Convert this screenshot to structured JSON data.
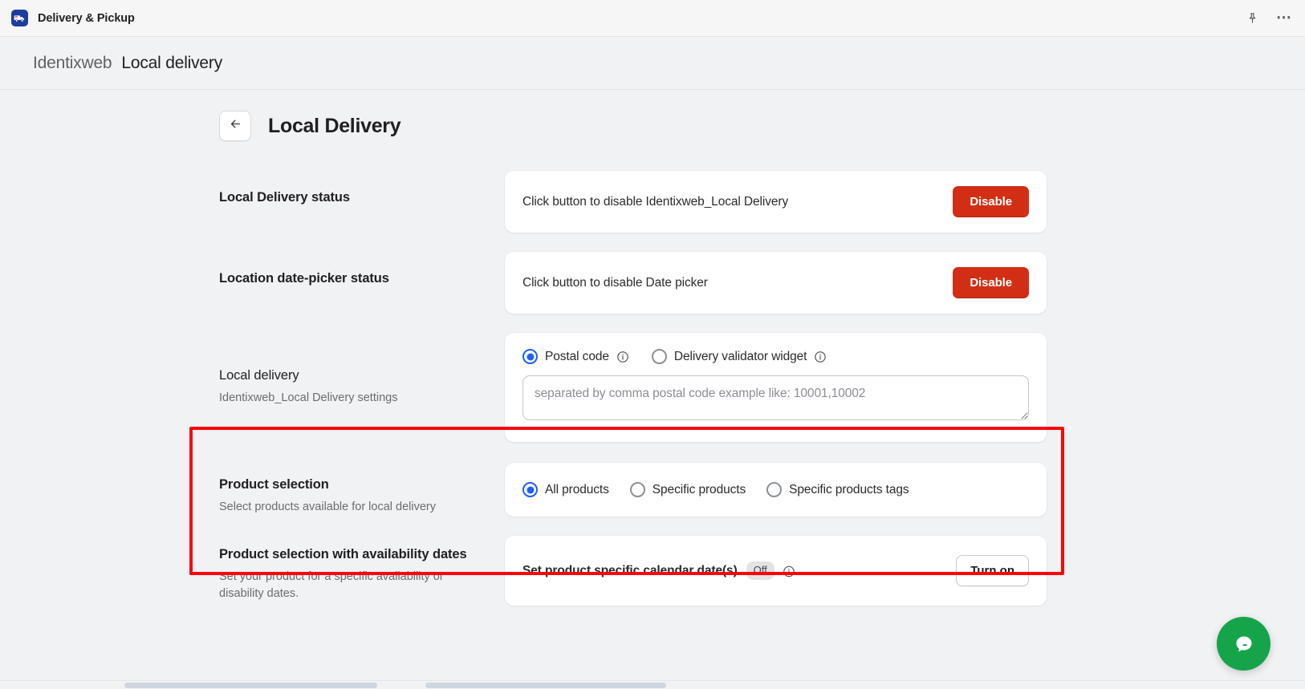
{
  "titlebar": {
    "app_name": "Delivery & Pickup",
    "app_icon": "delivery-truck-icon",
    "pin_icon": "pin-icon",
    "more_icon": "more-options-icon"
  },
  "breadcrumb": {
    "parent": "Identixweb",
    "current": "Local delivery"
  },
  "page": {
    "back_icon": "arrow-left-icon",
    "title": "Local Delivery"
  },
  "sections": [
    {
      "title": "Local Delivery status",
      "subtitle": "",
      "card_text": "Click button to disable Identixweb_Local Delivery",
      "button_label": "Disable",
      "button_style": "danger"
    },
    {
      "title": "Location date-picker status",
      "subtitle": "",
      "card_text": "Click button to disable Date picker",
      "button_label": "Disable",
      "button_style": "danger"
    }
  ],
  "local_delivery": {
    "title": "Local delivery",
    "subtitle": "Identixweb_Local Delivery settings",
    "options": [
      {
        "label": "Postal code",
        "checked": true,
        "info_icon": "info-circle-icon"
      },
      {
        "label": "Delivery validator widget",
        "checked": false,
        "info_icon": "info-circle-icon"
      }
    ],
    "textarea_value": "",
    "textarea_placeholder": "separated by comma postal code example like: 10001,10002"
  },
  "product_selection": {
    "title": "Product selection",
    "subtitle": "Select products available for local delivery",
    "options": [
      {
        "label": "All products",
        "checked": true
      },
      {
        "label": "Specific products",
        "checked": false
      },
      {
        "label": "Specific products tags",
        "checked": false
      }
    ]
  },
  "availability_dates": {
    "title": "Product selection with availability dates",
    "subtitle": "Set your product for a specific availability or disability dates.",
    "card_text": "Set product specific calendar date(s)",
    "status_badge": "Off",
    "info_icon": "info-circle-icon",
    "button_label": "Turn on"
  },
  "chat": {
    "icon": "chat-bubble-icon",
    "color": "#16a44b"
  },
  "colors": {
    "danger": "#d22e15",
    "accent": "#1f5eff",
    "highlight": "#fa0707",
    "page_bg": "#f1f2f4"
  }
}
